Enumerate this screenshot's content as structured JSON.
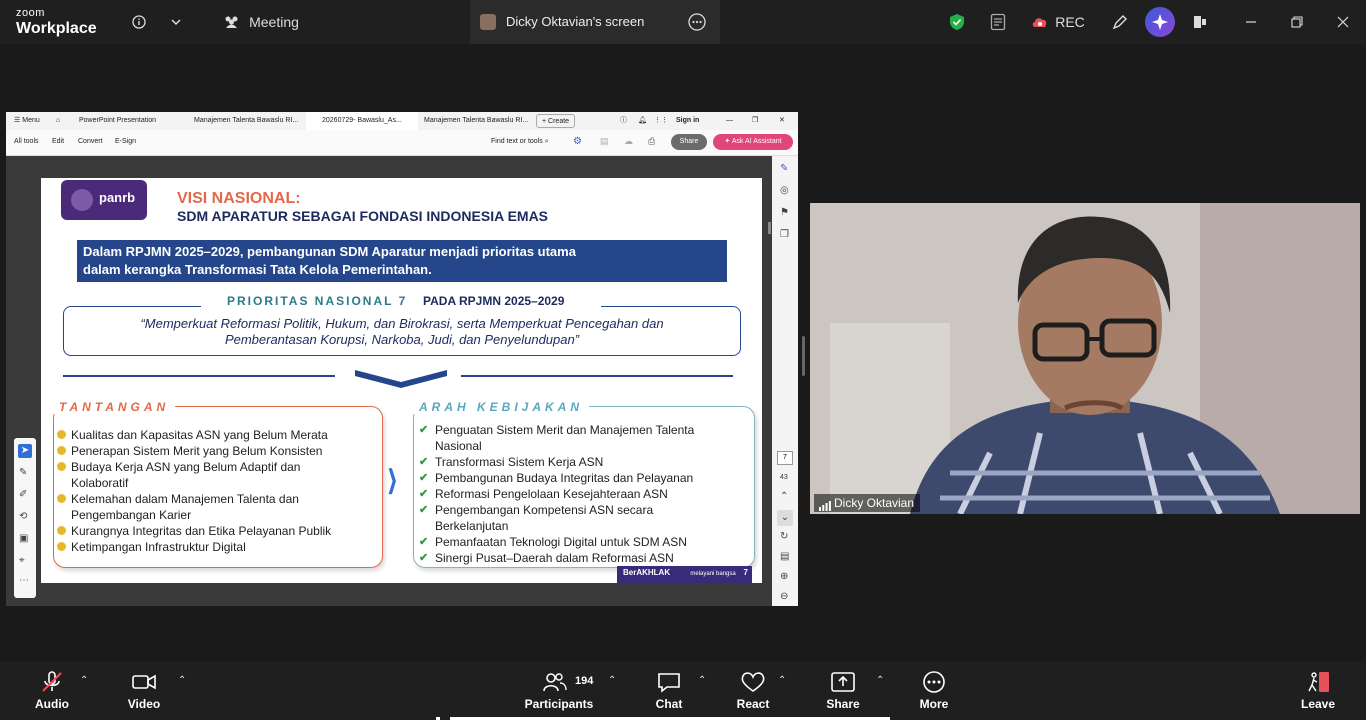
{
  "app": {
    "brand_top": "zoom",
    "brand_bottom": "Workplace"
  },
  "topbar": {
    "meeting_label": "Meeting",
    "share_tab_label": "Dicky Oktavian's screen",
    "rec_label": "REC"
  },
  "acrobat": {
    "menu": "Menu",
    "tabs": [
      "PowerPoint Presentation",
      "Manajemen Talenta Bawaslu RI...",
      "20260729- Bawaslu_As...",
      "Manajemen Talenta Bawaslu RI..."
    ],
    "create": "Create",
    "sign_in": "Sign in",
    "tools": [
      "All tools",
      "Edit",
      "Convert",
      "E-Sign"
    ],
    "find": "Find text or tools",
    "share": "Share",
    "ask_ai": "Ask AI Assistant",
    "page_num": "7",
    "page_total": "43"
  },
  "slide": {
    "logo": "panrb",
    "title1": "VISI NASIONAL:",
    "title2": "SDM APARATUR SEBAGAI FONDASI INDONESIA EMAS",
    "band_line1": "Dalam RPJMN 2025–2029, pembangunan SDM Aparatur menjadi prioritas utama",
    "band_line2": "dalam kerangka Transformasi Tata Kelola Pemerintahan.",
    "pn_label": "PRIORITAS NASIONAL 7",
    "pn_label2": "PADA RPJMN 2025–2029",
    "quote_line1": "“Memperkuat Reformasi Politik, Hukum, dan Birokrasi, serta Memperkuat Pencegahan dan",
    "quote_line2": "Pemberantasan Korupsi, Narkoba, Judi, dan Penyelundupan”",
    "tantangan_title": "TANTANGAN",
    "tantangan": [
      "Kualitas dan Kapasitas ASN yang Belum Merata",
      "Penerapan Sistem Merit yang Belum Konsisten",
      "Budaya Kerja ASN yang Belum Adaptif dan",
      "Kolaboratif",
      "Kelemahan dalam Manajemen Talenta dan",
      "Pengembangan Karier",
      "Kurangnya Integritas dan Etika Pelayanan Publik",
      "Ketimpangan Infrastruktur Digital"
    ],
    "arah_title": "ARAH KEBIJAKAN",
    "arah": [
      "Penguatan Sistem Merit dan Manajemen Talenta",
      "Nasional",
      "Transformasi Sistem Kerja ASN",
      "Pembangunan Budaya Integritas dan Pelayanan",
      "Reformasi Pengelolaan Kesejahteraan ASN",
      "Pengembangan Kompetensi ASN secara",
      "Berkelanjutan",
      "Pemanfaatan Teknologi Digital untuk SDM ASN",
      "Sinergi Pusat–Daerah dalam Reformasi ASN"
    ],
    "footer_badge": "BerAKHLAK",
    "footer_sub": "melayani bangsa",
    "footer_page": "7"
  },
  "video": {
    "name": "Dicky Oktavian"
  },
  "bottombar": {
    "audio": "Audio",
    "video": "Video",
    "participants": "Participants",
    "participants_count": "194",
    "chat": "Chat",
    "react": "React",
    "share": "Share",
    "more": "More",
    "leave": "Leave"
  },
  "colors": {
    "accent": "#25468a",
    "orange": "#e26a4a",
    "teal": "#2c7a8a",
    "ai": "#e0457b",
    "leave": "#e8505b"
  }
}
